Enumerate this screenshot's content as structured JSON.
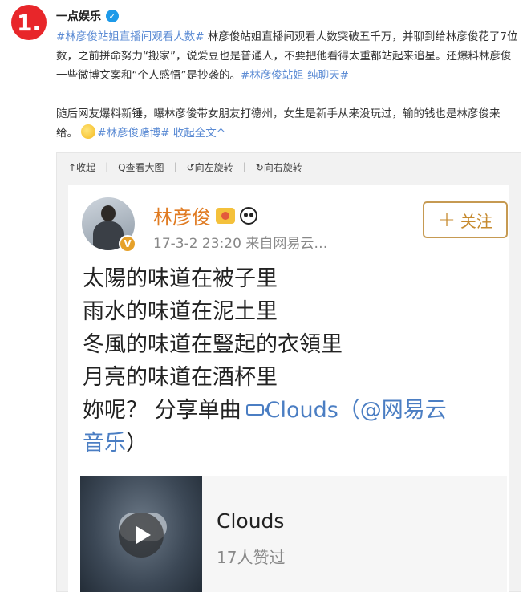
{
  "post": {
    "rank_badge": "1.",
    "author": "一点娱乐",
    "verified_mark": "✓",
    "para1": {
      "tag1": "#林彦俊站姐直播间观看人数#",
      "text1": " 林彦俊站姐直播间观看人数突破五千万，并聊到给林彦俊花了7位数，之前拼命努力“搬家”，说爱豆也是普通人，不要把他看得太重都站起来追星。还爆料林彦俊一些微博文案和“个人感悟”是抄袭的。",
      "tag2": "#林彦俊站姐 纯聊天#"
    },
    "para2": {
      "text1": "随后网友爆料新锤，曝林彦俊带女朋友打德州，女生是新手从来没玩过，输的钱也是林彦俊来给。",
      "tag1": "#林彦俊赌博#",
      "collapse": " 收起全文^"
    }
  },
  "viewer": {
    "toolbar": {
      "collapse": "↑收起",
      "view_large": "Q查看大图",
      "rotate_left": "↺向左旋转",
      "rotate_right": "↻向右旋转"
    },
    "screenshot": {
      "poster_name": "林彦俊",
      "verified_letter": "V",
      "meta": "17-3-2 23:20  来自网易云…",
      "follow_label": "关注",
      "follow_plus": "+",
      "lines": [
        "太陽的味道在被子里",
        "雨水的味道在泥土里",
        "冬風的味道在豎起的衣領里",
        "月亮的味道在酒杯里"
      ],
      "share_prefix": "妳呢？  分享单曲",
      "share_song": "Clouds（@网易云",
      "share_suffix": "音乐",
      "share_close": "）",
      "card": {
        "title": "Clouds",
        "likes": "17人赞过"
      }
    }
  }
}
